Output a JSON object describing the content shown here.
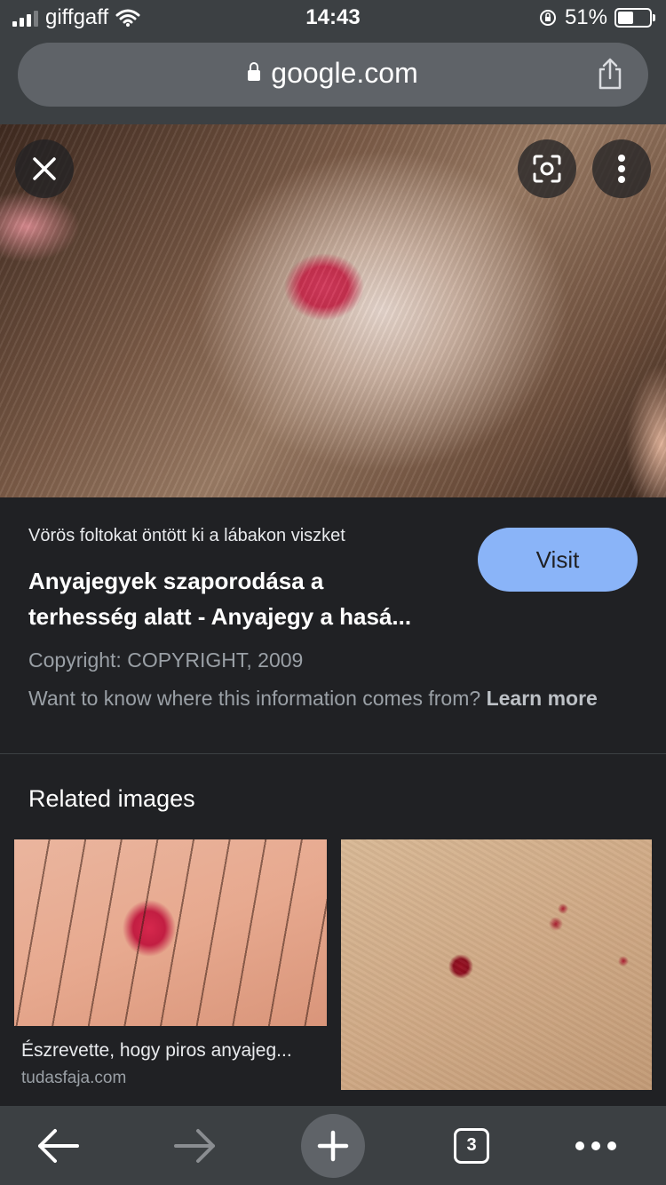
{
  "status_bar": {
    "carrier": "giffgaff",
    "time": "14:43",
    "battery_percent": "51%",
    "battery_level": 0.51
  },
  "address_bar": {
    "url": "google.com"
  },
  "image_viewer": {
    "close_icon": "close-icon",
    "lens_icon": "lens-icon",
    "menu_icon": "more-vert-icon"
  },
  "result": {
    "source_line": "Vörös foltokat öntött ki a lábakon viszket",
    "title_line1": "Anyajegyek szaporodása a",
    "title_line2": "terhesség alatt - Anyajegy a hasá...",
    "visit_label": "Visit",
    "copyright": "Copyright: COPYRIGHT, 2009",
    "info_text": "Want to know where this information comes from? ",
    "learn_more": "Learn more"
  },
  "related": {
    "heading": "Related images",
    "items": [
      {
        "caption": "Észrevette, hogy piros anyajeg...",
        "domain": "tudasfaja.com"
      },
      {
        "caption": "",
        "domain": ""
      }
    ]
  },
  "toolbar": {
    "tab_count": "3",
    "icons": [
      "back-arrow-icon",
      "forward-arrow-icon",
      "new-tab-icon",
      "tab-switcher-icon",
      "more-horiz-icon"
    ]
  },
  "colors": {
    "background": "#202124",
    "bar": "#3c4043",
    "accent": "#8ab4f8",
    "muted_text": "#9aa0a6"
  }
}
